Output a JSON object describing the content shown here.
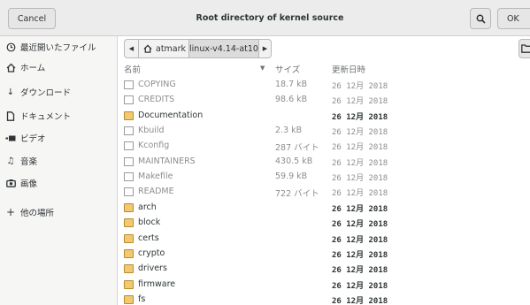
{
  "header": {
    "cancel_label": "Cancel",
    "title": "Root directory of kernel source",
    "ok_label": "OK"
  },
  "sidebar": {
    "items": [
      {
        "label": "最近開いたファイル",
        "icon": "clock-icon"
      },
      {
        "label": "ホーム",
        "icon": "home-icon"
      },
      {
        "label": "ダウンロード",
        "icon": "download-icon"
      },
      {
        "label": "ドキュメント",
        "icon": "document-icon"
      },
      {
        "label": "ビデオ",
        "icon": "video-icon"
      },
      {
        "label": "音楽",
        "icon": "music-icon"
      },
      {
        "label": "画像",
        "icon": "camera-icon"
      },
      {
        "label": "他の場所",
        "icon": "plus-icon"
      }
    ]
  },
  "pathbar": {
    "home_label": "atmark",
    "current_dir": "linux-v4.14-at10"
  },
  "columns": {
    "name": "名前",
    "size": "サイズ",
    "modified": "更新日時"
  },
  "files": [
    {
      "name": "COPYING",
      "size": "18.7 kB",
      "date": "26 12月 2018",
      "type": "file"
    },
    {
      "name": "CREDITS",
      "size": "98.6 kB",
      "date": "26 12月 2018",
      "type": "file"
    },
    {
      "name": "Documentation",
      "size": "",
      "date": "26 12月 2018",
      "type": "dir"
    },
    {
      "name": "Kbuild",
      "size": "2.3 kB",
      "date": "26 12月 2018",
      "type": "file"
    },
    {
      "name": "Kconfig",
      "size": "287 バイト",
      "date": "26 12月 2018",
      "type": "file"
    },
    {
      "name": "MAINTAINERS",
      "size": "430.5 kB",
      "date": "26 12月 2018",
      "type": "file"
    },
    {
      "name": "Makefile",
      "size": "59.9 kB",
      "date": "26 12月 2018",
      "type": "file"
    },
    {
      "name": "README",
      "size": "722 バイト",
      "date": "26 12月 2018",
      "type": "file"
    },
    {
      "name": "arch",
      "size": "",
      "date": "26 12月 2018",
      "type": "dir"
    },
    {
      "name": "block",
      "size": "",
      "date": "26 12月 2018",
      "type": "dir"
    },
    {
      "name": "certs",
      "size": "",
      "date": "26 12月 2018",
      "type": "dir"
    },
    {
      "name": "crypto",
      "size": "",
      "date": "26 12月 2018",
      "type": "dir"
    },
    {
      "name": "drivers",
      "size": "",
      "date": "26 12月 2018",
      "type": "dir"
    },
    {
      "name": "firmware",
      "size": "",
      "date": "26 12月 2018",
      "type": "dir"
    },
    {
      "name": "fs",
      "size": "",
      "date": "26 12月 2018",
      "type": "dir"
    }
  ]
}
